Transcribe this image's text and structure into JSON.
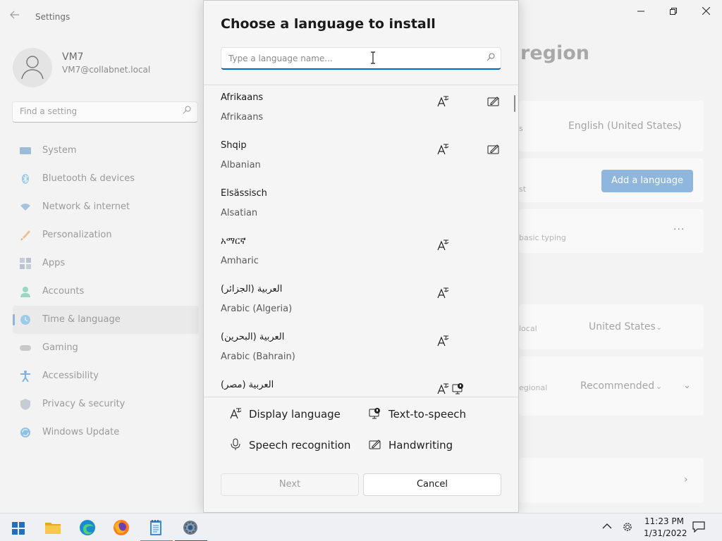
{
  "settings": {
    "app_title": "Settings",
    "profile": {
      "name": "VM7",
      "email": "VM7@collabnet.local"
    },
    "search_placeholder": "Find a setting",
    "nav": [
      {
        "label": "System",
        "icon": "monitor-icon",
        "color": "#6b9bc7"
      },
      {
        "label": "Bluetooth & devices",
        "icon": "bluetooth-icon",
        "color": "#5aa6d8"
      },
      {
        "label": "Network & internet",
        "icon": "wifi-icon",
        "color": "#6b8fbd"
      },
      {
        "label": "Personalization",
        "icon": "brush-icon",
        "color": "#e0a05a"
      },
      {
        "label": "Apps",
        "icon": "apps-icon",
        "color": "#8aa1b6"
      },
      {
        "label": "Accounts",
        "icon": "person-icon",
        "color": "#5bbf9b"
      },
      {
        "label": "Time & language",
        "icon": "globe-clock-icon",
        "color": "#5aa6d8",
        "active": true
      },
      {
        "label": "Gaming",
        "icon": "controller-icon",
        "color": "#a6a6a6"
      },
      {
        "label": "Accessibility",
        "icon": "accessibility-icon",
        "color": "#3b8fd6"
      },
      {
        "label": "Privacy & security",
        "icon": "shield-icon",
        "color": "#9aa6b2"
      },
      {
        "label": "Windows Update",
        "icon": "update-icon",
        "color": "#3b8fd6"
      }
    ],
    "page_title_fragment": "region",
    "background_fragments": {
      "display_lang_suffix": "s",
      "display_lang_value": "English (United States)",
      "preferred_suffix": "st",
      "add_language": "Add a language",
      "basic_typing": "basic typing",
      "country_label": "local",
      "country_value": "United States",
      "regional_label": "egional",
      "regional_value": "Recommended"
    }
  },
  "dialog": {
    "title": "Choose a language to install",
    "search_placeholder": "Type a language name...",
    "languages": [
      {
        "native": "Afrikaans",
        "english": "Afrikaans",
        "features": [
          "display-language-icon",
          "handwriting-icon"
        ]
      },
      {
        "native": "Shqip",
        "english": "Albanian",
        "features": [
          "display-language-icon",
          "handwriting-icon"
        ]
      },
      {
        "native": "Elsässisch",
        "english": "Alsatian",
        "features": []
      },
      {
        "native": "አማርኛ",
        "english": "Amharic",
        "features": [
          "display-language-icon"
        ]
      },
      {
        "native": "العربية (الجزائر)",
        "english": "Arabic (Algeria)",
        "features": [
          "display-language-icon"
        ]
      },
      {
        "native": "العربية (البحرين)",
        "english": "Arabic (Bahrain)",
        "features": [
          "display-language-icon"
        ]
      },
      {
        "native": "العربية (مصر)",
        "english": "",
        "features": [
          "display-language-icon",
          "text-to-speech-icon"
        ]
      }
    ],
    "legend": {
      "display_language": "Display language",
      "text_to_speech": "Text-to-speech",
      "speech_recognition": "Speech recognition",
      "handwriting": "Handwriting"
    },
    "next_label": "Next",
    "cancel_label": "Cancel"
  },
  "taskbar": {
    "apps": [
      "start-icon",
      "file-explorer-icon",
      "edge-icon",
      "firefox-icon",
      "notepad-icon",
      "settings-icon"
    ],
    "time": "11:23 PM",
    "date": "1/31/2022"
  },
  "colors": {
    "accent": "#0067c0",
    "add_button_bg": "#8fb6dd"
  }
}
